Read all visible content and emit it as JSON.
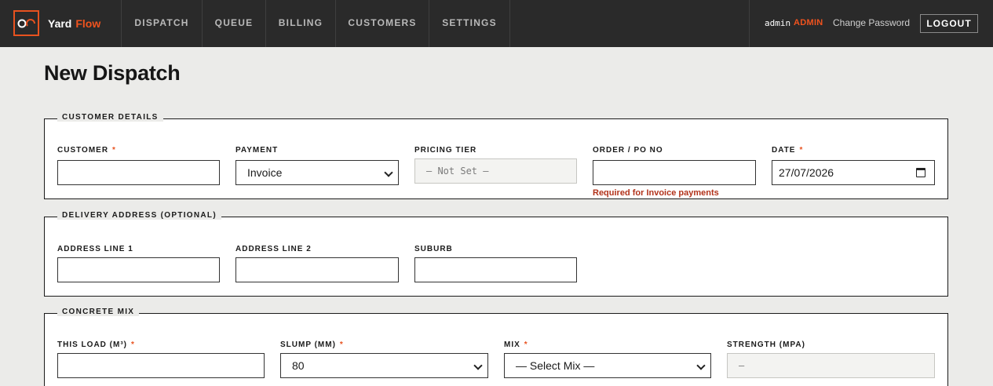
{
  "header": {
    "brand_first": "Yard",
    "brand_second": "Flow",
    "nav": [
      {
        "label": "DISPATCH"
      },
      {
        "label": "QUEUE"
      },
      {
        "label": "BILLING"
      },
      {
        "label": "CUSTOMERS"
      },
      {
        "label": "SETTINGS"
      }
    ],
    "user_name": "admin",
    "user_role": "ADMIN",
    "change_password": "Change Password",
    "logout": "LOGOUT",
    "accent_color": "#f0531e"
  },
  "page": {
    "title": "New Dispatch"
  },
  "customer_details": {
    "legend": "CUSTOMER DETAILS",
    "customer_label": "CUSTOMER",
    "customer_value": "",
    "payment_label": "PAYMENT",
    "payment_value": "Invoice",
    "pricing_tier_label": "PRICING TIER",
    "pricing_tier_value": "— Not Set —",
    "order_label": "ORDER / PO NO",
    "order_value": "",
    "order_hint": "Required for Invoice payments",
    "date_label": "DATE",
    "date_value": "27/07/2026",
    "required_mark": "*"
  },
  "delivery_address": {
    "legend": "DELIVERY ADDRESS (OPTIONAL)",
    "line1_label": "ADDRESS LINE 1",
    "line1_value": "",
    "line2_label": "ADDRESS LINE 2",
    "line2_value": "",
    "suburb_label": "SUBURB",
    "suburb_value": ""
  },
  "concrete_mix": {
    "legend": "CONCRETE MIX",
    "load_label": "THIS LOAD (M³)",
    "load_value": "",
    "slump_label": "SLUMP (MM)",
    "slump_value": "80",
    "mix_label": "MIX",
    "mix_value": "— Select Mix —",
    "strength_label": "STRENGTH (MPA)",
    "strength_value": "—",
    "required_mark": "*"
  }
}
